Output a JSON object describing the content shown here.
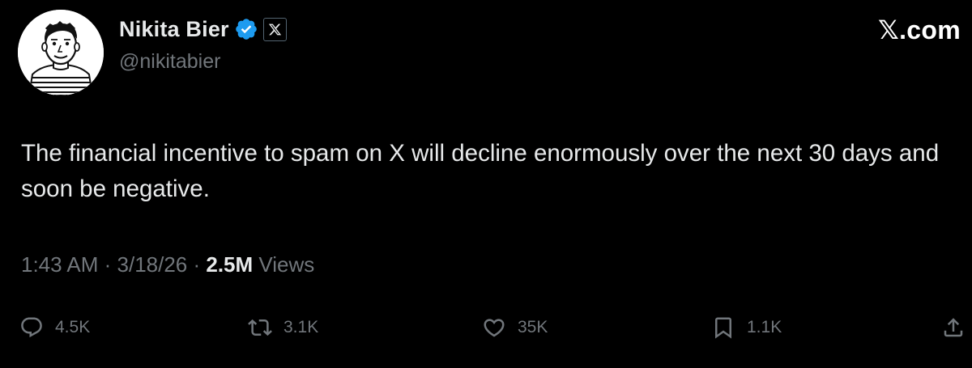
{
  "author": {
    "name": "Nikita Bier",
    "handle": "@nikitabier"
  },
  "brand": {
    "text": ".com",
    "x_glyph": "𝕏"
  },
  "icons": {
    "verified": "verified-badge-icon",
    "affiliation": "x-logo-icon",
    "reply": "reply-icon",
    "repost": "repost-icon",
    "like": "heart-icon",
    "bookmark": "bookmark-icon",
    "share": "share-icon"
  },
  "colors": {
    "background": "#000000",
    "text_primary": "#e7e9ea",
    "text_secondary": "#71767b",
    "verified_blue": "#1d9bf0"
  },
  "tweet": {
    "text": "The financial incentive to spam on X will decline enormously over the next 30 days and soon be negative."
  },
  "meta": {
    "time": "1:43 AM",
    "separator": " · ",
    "date": "3/18/26",
    "views_count": "2.5M",
    "views_label": " Views"
  },
  "actions": {
    "replies": "4.5K",
    "reposts": "3.1K",
    "likes": "35K",
    "bookmarks": "1.1K"
  }
}
